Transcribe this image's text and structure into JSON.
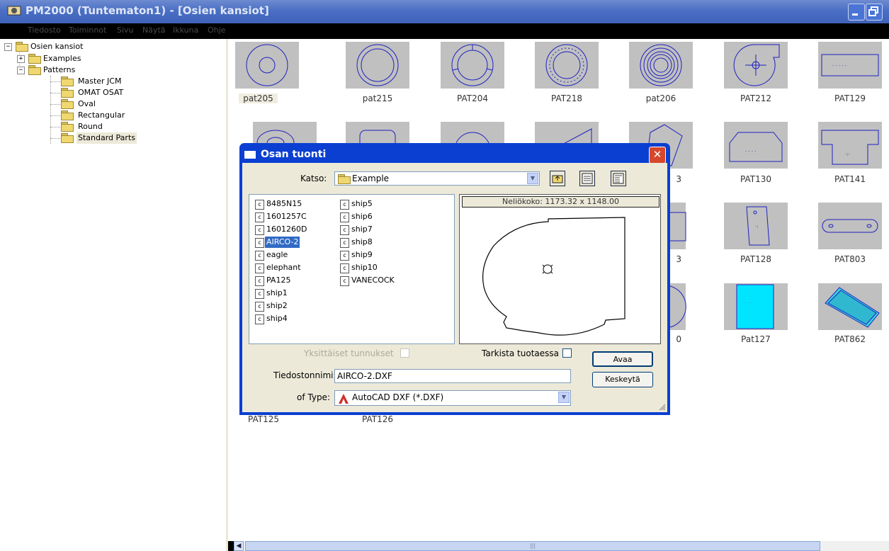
{
  "window": {
    "title": "PM2000 (Tuntematon1) - [Osien kansiot]"
  },
  "menu": [
    "Tiedosto",
    "Toiminnot",
    "Sivu",
    "Näytä",
    "Ikkuna",
    "Ohje"
  ],
  "tree": {
    "root": "Osien kansiot",
    "examples": "Examples",
    "patterns": "Patterns",
    "children": [
      "Master JCM",
      "OMAT OSAT",
      "Oval",
      "Rectangular",
      "Round",
      "Standard Parts"
    ]
  },
  "thumbnails": [
    "pat205",
    "pat215",
    "PAT204",
    "PAT218",
    "pat206",
    "PAT212",
    "PAT129",
    "PAT130",
    "PAT141",
    "PAT128",
    "PAT803",
    "Pat127",
    "PAT862",
    "PAT125",
    "PAT126"
  ],
  "partial_labels": [
    "3",
    "3",
    "0"
  ],
  "dialog": {
    "title": "Osan tuonti",
    "look_in_label": "Katso:",
    "look_in_value": "Example",
    "files_col1": [
      "8485N15",
      "1601257C",
      "1601260D",
      "AIRCO-2",
      "eagle",
      "elephant",
      "PA125",
      "ship1",
      "ship2",
      "ship4"
    ],
    "files_col2": [
      "ship5",
      "ship6",
      "ship7",
      "ship8",
      "ship9",
      "ship10",
      "VANECOCK"
    ],
    "selected_file": "AIRCO-2",
    "preview_header": "Neliökoko: 1173.32 x 1148.00",
    "single_ids_label": "Yksittäiset tunnukset",
    "check_on_import_label": "Tarkista tuotaessa",
    "open_button": "Avaa",
    "cancel_button": "Keskeytä",
    "filename_label": "Tiedostonnimi:",
    "filename_value": "AIRCO-2.DXF",
    "type_label": "of Type:",
    "type_value": "AutoCAD DXF (*.DXF)"
  },
  "colors": {
    "titlebar": "#4a6fc4",
    "dialog_frame": "#0a3fd1",
    "selection": "#316ac5",
    "thumb_bg": "#c0c0c0",
    "cad_line": "#2020c0"
  }
}
